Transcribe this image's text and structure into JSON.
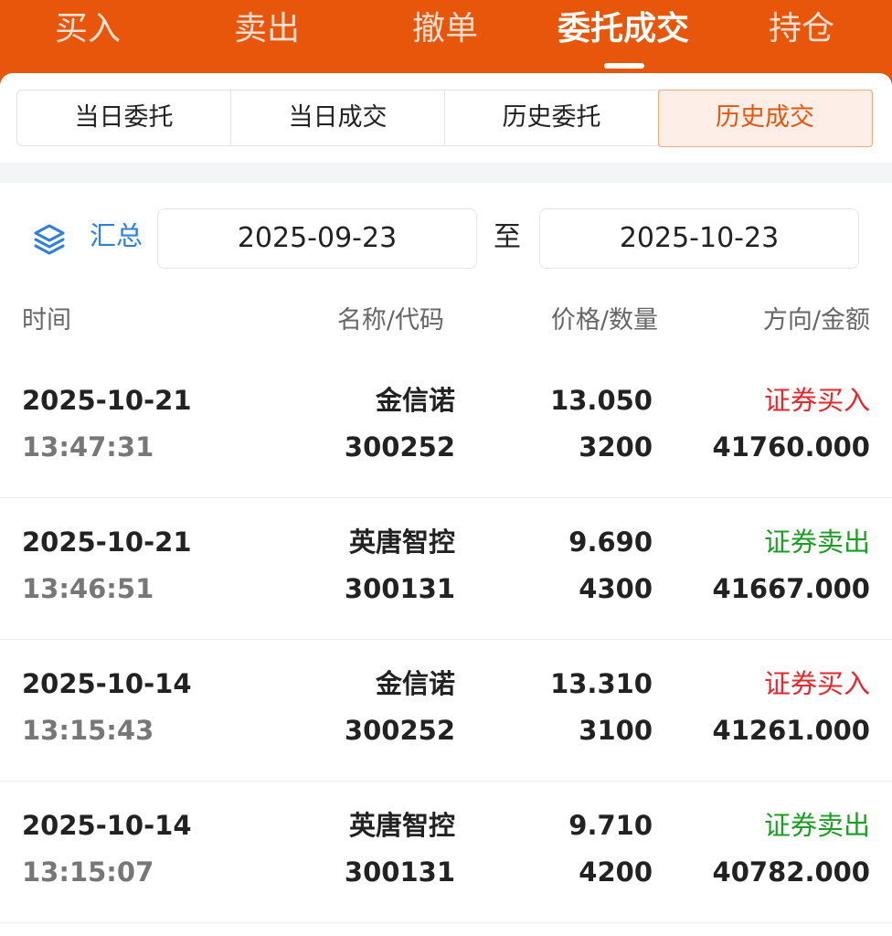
{
  "top_tabs": [
    {
      "label": "买入"
    },
    {
      "label": "卖出"
    },
    {
      "label": "撤单"
    },
    {
      "label": "委托成交"
    },
    {
      "label": "持仓"
    }
  ],
  "active_top_tab": "委托成交",
  "segments": [
    {
      "label": "当日委托"
    },
    {
      "label": "当日成交"
    },
    {
      "label": "历史委托"
    },
    {
      "label": "历史成交"
    }
  ],
  "active_segment": "历史成交",
  "filter": {
    "summary_label": "汇总",
    "date_from": "2025-09-23",
    "to_label": "至",
    "date_to": "2025-10-23"
  },
  "columns": {
    "time": "时间",
    "name_code": "名称/代码",
    "price_qty": "价格/数量",
    "direction_amount": "方向/金额"
  },
  "colors": {
    "brand": "#e8560c",
    "buy": "#e8262b",
    "sell": "#1b9e24",
    "link": "#2e7fe0"
  },
  "rows": [
    {
      "date": "2025-10-21",
      "time": "13:47:31",
      "name": "金信诺",
      "code": "300252",
      "price": "13.050",
      "qty": "3200",
      "direction": "证券买入",
      "side": "buy",
      "amount": "41760.000"
    },
    {
      "date": "2025-10-21",
      "time": "13:46:51",
      "name": "英唐智控",
      "code": "300131",
      "price": "9.690",
      "qty": "4300",
      "direction": "证券卖出",
      "side": "sell",
      "amount": "41667.000"
    },
    {
      "date": "2025-10-14",
      "time": "13:15:43",
      "name": "金信诺",
      "code": "300252",
      "price": "13.310",
      "qty": "3100",
      "direction": "证券买入",
      "side": "buy",
      "amount": "41261.000"
    },
    {
      "date": "2025-10-14",
      "time": "13:15:07",
      "name": "英唐智控",
      "code": "300131",
      "price": "9.710",
      "qty": "4200",
      "direction": "证券卖出",
      "side": "sell",
      "amount": "40782.000"
    }
  ]
}
